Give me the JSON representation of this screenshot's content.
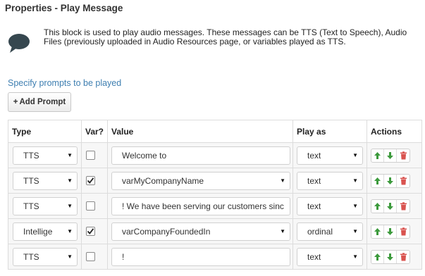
{
  "panel": {
    "title": "Properties - Play Message",
    "description": "This block is used to play audio messages. These messages can be TTS (Text to Speech), Audio Files (previously uploaded in Audio Resources page, or variables played as TTS.",
    "specify_label": "Specify prompts to be played",
    "add_prompt_label": "Add Prompt"
  },
  "table": {
    "headers": [
      "Type",
      "Var?",
      "Value",
      "Play as",
      "Actions"
    ],
    "rows": [
      {
        "type": "TTS",
        "var": false,
        "value": "Welcome to",
        "play_as": "text"
      },
      {
        "type": "TTS",
        "var": true,
        "value": "varMyCompanyName",
        "play_as": "text"
      },
      {
        "type": "TTS",
        "var": false,
        "value": "! We have been serving our customers sinc",
        "play_as": "text"
      },
      {
        "type": "Intellige",
        "var": true,
        "value": "varCompanyFoundedIn",
        "play_as": "ordinal"
      },
      {
        "type": "TTS",
        "var": false,
        "value": "!",
        "play_as": "text"
      }
    ]
  },
  "colors": {
    "link": "#3f7fb1",
    "move_up": "#3c9a3c",
    "move_down": "#3c9a3c",
    "delete": "#d9534f"
  },
  "icons": {
    "panel_icon": "speech-bubble-icon",
    "add": "plus-icon",
    "up": "arrow-up-icon",
    "down": "arrow-down-icon",
    "delete": "trash-icon",
    "dropdown": "caret-down-icon"
  }
}
